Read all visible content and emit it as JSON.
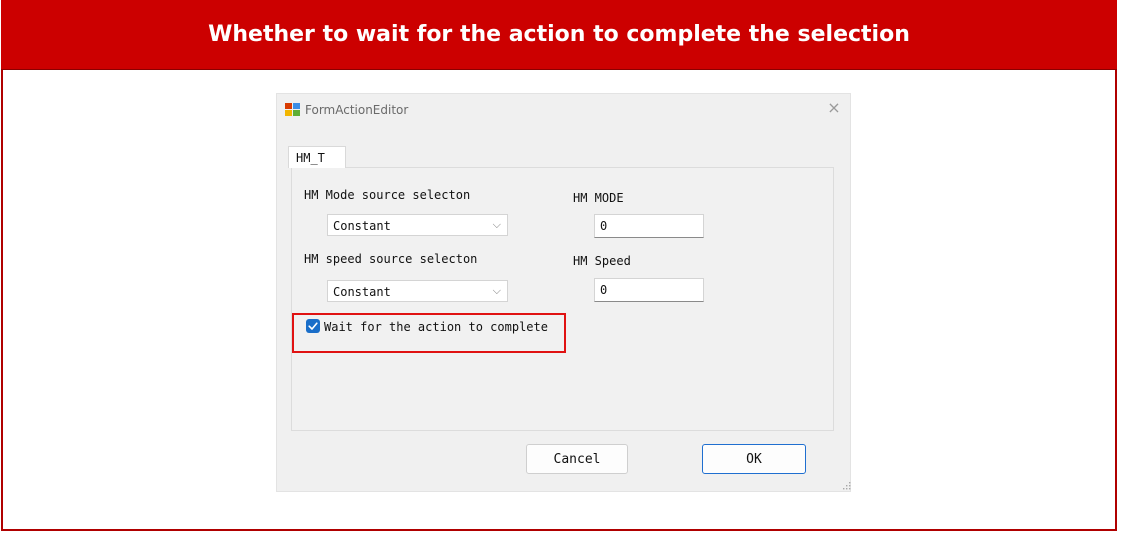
{
  "banner": {
    "title": "Whether to wait for the action to complete the selection"
  },
  "dialog": {
    "title": "FormActionEditor",
    "close_glyph": "×",
    "tab_label": "HM_T",
    "fields": {
      "mode_source_label": "HM Mode source selecton",
      "mode_source_value": "Constant",
      "speed_source_label": "HM speed source selecton",
      "speed_source_value": "Constant",
      "mode_label": "HM MODE",
      "mode_value": "0",
      "speed_label": "HM Speed",
      "speed_value": "0"
    },
    "wait_checkbox": {
      "label": "Wait for the action to complete",
      "checked": true
    },
    "buttons": {
      "cancel": "Cancel",
      "ok": "OK"
    },
    "dropdown_glyph": "⌵"
  },
  "colors": {
    "banner_red": "#cc0000",
    "highlight_red": "#e01212",
    "checkbox_blue": "#1a6ec9",
    "ok_border_blue": "#1f6fd0"
  },
  "icons": [
    "form-app-icon",
    "close-icon",
    "chevron-down-icon",
    "checkmark-icon",
    "resize-grip-icon"
  ]
}
